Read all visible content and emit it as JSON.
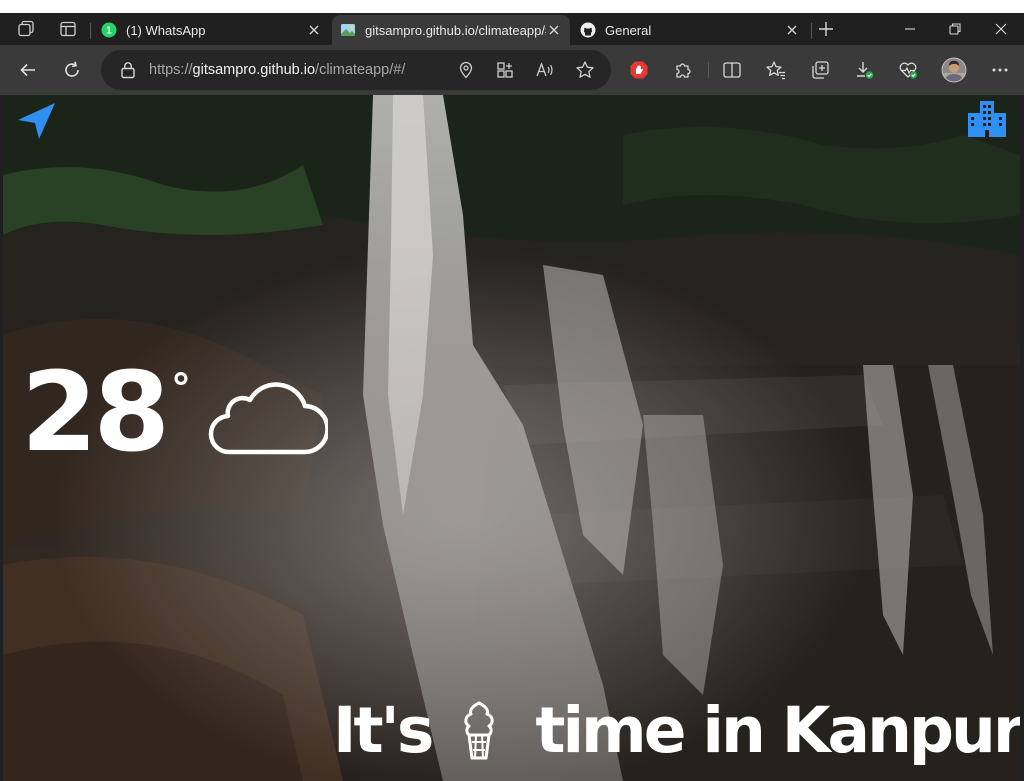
{
  "browser": {
    "tabs": [
      {
        "title": "(1) WhatsApp",
        "favicon": "whatsapp-icon",
        "badge": "1",
        "active": false
      },
      {
        "title": "gitsampro.github.io/climateapp/#/",
        "favicon": "image-icon",
        "active": true
      },
      {
        "title": "General",
        "favicon": "github-icon",
        "active": false
      }
    ],
    "address": {
      "scheme": "https://",
      "host": "gitsampro.github.io",
      "path": "/climateapp/#/"
    }
  },
  "weather": {
    "temperature": "28",
    "degree_symbol": "°",
    "condition_icon": "cloud-icon",
    "message_prefix": "It's",
    "message_icon": "ice-cream-icon",
    "message_suffix": "time in Kanpur"
  },
  "colors": {
    "accent": "#2f8ff2",
    "tab_bar": "#202020",
    "toolbar": "#3a3a3a",
    "whatsapp": "#25d366",
    "text": "#ffffff"
  }
}
